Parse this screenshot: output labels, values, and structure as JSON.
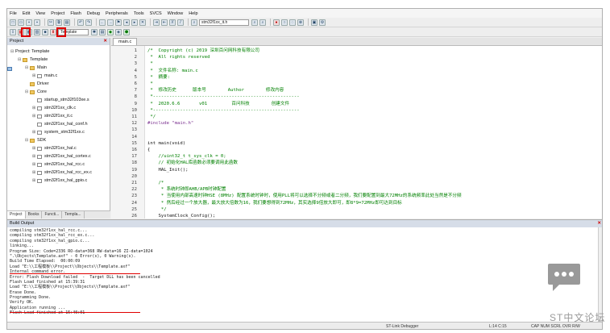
{
  "menu": [
    "File",
    "Edit",
    "View",
    "Project",
    "Flash",
    "Debug",
    "Peripherals",
    "Tools",
    "SVCS",
    "Window",
    "Help"
  ],
  "toolbar": {
    "file_combo": "stm32f1xx_it.h",
    "target_combo": "Template"
  },
  "project_panel": {
    "title": "Project",
    "tree": [
      {
        "label": "Project: Template",
        "level": 0,
        "type": "proj",
        "exp": "⊟"
      },
      {
        "label": "Template",
        "level": 1,
        "type": "folder",
        "exp": "⊟"
      },
      {
        "label": "Main",
        "level": 2,
        "type": "folder",
        "exp": "⊟"
      },
      {
        "label": "main.c",
        "level": 3,
        "type": "file",
        "exp": "⊞"
      },
      {
        "label": "Driver",
        "level": 2,
        "type": "folder",
        "exp": ""
      },
      {
        "label": "Core",
        "level": 2,
        "type": "folder",
        "exp": "⊟"
      },
      {
        "label": "startup_stm32f103xe.s",
        "level": 3,
        "type": "file",
        "exp": ""
      },
      {
        "label": "stm32f1xx_clk.c",
        "level": 3,
        "type": "file",
        "exp": "⊞"
      },
      {
        "label": "stm32f1xx_it.c",
        "level": 3,
        "type": "file",
        "exp": "⊞"
      },
      {
        "label": "stm32f1xx_hal_conf.h",
        "level": 3,
        "type": "file",
        "exp": ""
      },
      {
        "label": "system_stm32f1xx.c",
        "level": 3,
        "type": "file",
        "exp": "⊞"
      },
      {
        "label": "SDK",
        "level": 2,
        "type": "folder",
        "exp": "⊟"
      },
      {
        "label": "stm32f1xx_hal.c",
        "level": 3,
        "type": "file",
        "exp": "⊞"
      },
      {
        "label": "stm32f1xx_hal_cortex.c",
        "level": 3,
        "type": "file",
        "exp": "⊞"
      },
      {
        "label": "stm32f1xx_hal_rcc.c",
        "level": 3,
        "type": "file",
        "exp": "⊞"
      },
      {
        "label": "stm32f1xx_hal_rcc_ex.c",
        "level": 3,
        "type": "file",
        "exp": "⊞"
      },
      {
        "label": "stm32f1xx_hal_gpio.c",
        "level": 3,
        "type": "file",
        "exp": "⊞"
      }
    ],
    "tabs": [
      "Project",
      "Books",
      "Functi...",
      "Templa..."
    ]
  },
  "editor": {
    "tab": "main.c",
    "lines": [
      {
        "n": "1",
        "t": "/*  Copyright (c) 2019 深圳百问网科技有限公司",
        "c": "c-comment"
      },
      {
        "n": "2",
        "t": " *  All rights reserved",
        "c": "c-comment"
      },
      {
        "n": "3",
        "t": " *",
        "c": "c-comment"
      },
      {
        "n": "4",
        "t": " *  文件名称: main.c",
        "c": "c-comment"
      },
      {
        "n": "5",
        "t": " *  摘要:",
        "c": "c-comment"
      },
      {
        "n": "6",
        "t": " *",
        "c": "c-comment"
      },
      {
        "n": "7",
        "t": " *  修改历史      版本号        Author        修改内容",
        "c": "c-comment"
      },
      {
        "n": "8",
        "t": " *------------------------------------------------------",
        "c": "c-comment"
      },
      {
        "n": "9",
        "t": " *  2020.6.6       v01         百问科技        创建文件",
        "c": "c-comment"
      },
      {
        "n": "10",
        "t": " *------------------------------------------------------",
        "c": "c-comment"
      },
      {
        "n": "11",
        "t": " */",
        "c": "c-comment"
      },
      {
        "n": "12",
        "t": "#include \"main.h\"",
        "c": "c-pre"
      },
      {
        "n": "13",
        "t": "",
        "c": "c-norm"
      },
      {
        "n": "14",
        "t": "",
        "c": "c-norm"
      },
      {
        "n": "15",
        "t": "int main(void)",
        "c": "c-norm"
      },
      {
        "n": "16",
        "t": "{",
        "c": "c-norm"
      },
      {
        "n": "17",
        "t": "    //uint32_t t_sys_clk = 0;",
        "c": "c-comment"
      },
      {
        "n": "18",
        "t": "    // 初始化HAL库函数必须要调用此函数",
        "c": "c-comment"
      },
      {
        "n": "19",
        "t": "    HAL_Init();",
        "c": "c-norm"
      },
      {
        "n": "20",
        "t": "",
        "c": "c-norm"
      },
      {
        "n": "21",
        "t": "    /*",
        "c": "c-comment"
      },
      {
        "n": "22",
        "t": "     * 系统时钟即AHB/APB时钟配置",
        "c": "c-comment"
      },
      {
        "n": "23",
        "t": "     * 当使用内部高速时钟HSE (8MHz) 配置系统时钟时，使用PLL将可以选择不分频或者二分频，我们要配置到最大72MHz的系统频率此处当然是不分频",
        "c": "c-comment"
      },
      {
        "n": "24",
        "t": "     * 然后经过一个放大器，最大放大倍数为16，我们要想得到72MHz，其实选择9倍放大即可，即8*9=72MHz即可达到目标",
        "c": "c-comment"
      },
      {
        "n": "25",
        "t": "     */",
        "c": "c-comment"
      },
      {
        "n": "26",
        "t": "    SystemClock_Config();",
        "c": "c-norm"
      }
    ]
  },
  "build": {
    "title": "Build Output",
    "lines": [
      "compiling stm32f1xx_hal_rcc.c...",
      "compiling stm32f1xx_hal_rcc_ex.c...",
      "compiling stm32f1xx_hal_gpio.c...",
      "linking...",
      "Program Size: Code=2336 RO-data=368 RW-data=16 ZI-data=1024",
      "\".\\Objects\\Template.axf\" - 0 Error(s), 0 Warning(s).",
      "Build Time Elapsed:  00:00:09",
      "Load \"E:\\\\工程模板\\\\Project\\\\Objects\\\\Template.axf\"",
      "Internal command error.",
      "Error: Flash Download failed  -  Target DLL has been cancelled",
      "Flash Load finished at 15:39:31",
      "Load \"E:\\\\工程模板\\\\Project\\\\Objects\\\\Template.axf\"",
      "Erase Done.",
      "Programming Done.",
      "Verify OK.",
      "Application running ...",
      "Flash Load finished at 15:40:01"
    ]
  },
  "status": {
    "debugger": "ST-Link Debugger",
    "position": "L:14 C:15",
    "caps": "CAP  NUM  SCRL  OVR  R/W"
  },
  "watermark": "ST中文论坛"
}
